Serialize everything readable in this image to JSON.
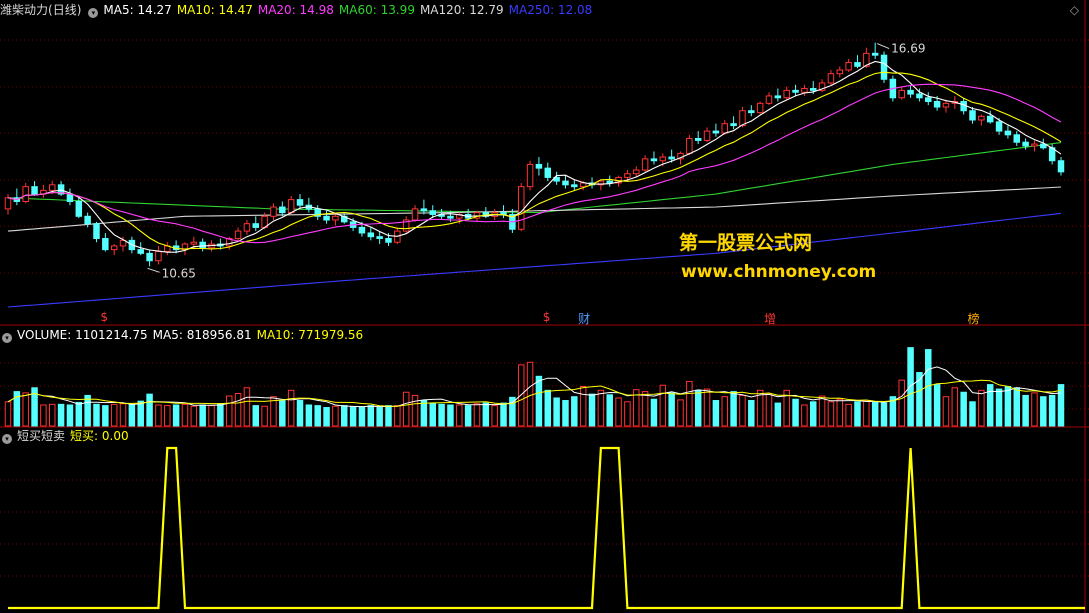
{
  "main_panel": {
    "stock_name": "潍柴动力",
    "period": "(日线)",
    "ma_labels": [
      {
        "text": "MA5: 14.27",
        "color": "#ffffff"
      },
      {
        "text": "MA10: 14.47",
        "color": "#ffff00"
      },
      {
        "text": "MA20: 14.98",
        "color": "#ff3cff"
      },
      {
        "text": "MA60: 13.99",
        "color": "#2fd32f"
      },
      {
        "text": "MA120: 12.79",
        "color": "#d8d8d8"
      },
      {
        "text": "MA250: 12.08",
        "color": "#3a3aff"
      }
    ],
    "high_label": "16.69",
    "low_label": "10.65",
    "close_glyph": "◇",
    "events": [
      {
        "text": "$",
        "color": "#ff3333"
      },
      {
        "text": "$",
        "color": "#ff3333"
      },
      {
        "text": "财",
        "color": "#5599ff"
      },
      {
        "text": "增",
        "color": "#ff3333"
      },
      {
        "text": "榜",
        "color": "#ffaa00"
      }
    ]
  },
  "watermark": {
    "line1": "第一股票公式网",
    "line2": "www.chnmoney.com"
  },
  "volume_panel": {
    "labels": [
      {
        "text": "VOLUME: 1101214.75",
        "color": "#ffffff"
      },
      {
        "text": "MA5: 818956.81",
        "color": "#ffffff"
      },
      {
        "text": "MA10: 771979.56",
        "color": "#ffff00"
      }
    ]
  },
  "indicator_panel": {
    "name": "短买短卖",
    "labels": [
      {
        "text": "短买: 0.00",
        "color": "#ffff00"
      }
    ]
  },
  "colors": {
    "up": "#ff3333",
    "down": "#55ffff",
    "grid": "#7a0000",
    "separator": "#a00000",
    "signal": "#ffff00"
  },
  "chart_data": [
    {
      "type": "candlestick",
      "title": "潍柴动力 (日线)",
      "x_count": 120,
      "price_range": [
        9.2,
        17.3
      ],
      "ohlc": [
        [
          12.2,
          12.6,
          12.05,
          12.5
        ],
        [
          12.5,
          12.75,
          12.3,
          12.4
        ],
        [
          12.4,
          12.9,
          12.35,
          12.8
        ],
        [
          12.8,
          12.95,
          12.55,
          12.6
        ],
        [
          12.6,
          12.85,
          12.5,
          12.7
        ],
        [
          12.7,
          12.95,
          12.6,
          12.85
        ],
        [
          12.85,
          12.95,
          12.55,
          12.6
        ],
        [
          12.6,
          12.75,
          12.3,
          12.4
        ],
        [
          12.4,
          12.5,
          11.95,
          12.0
        ],
        [
          12.0,
          12.1,
          11.7,
          11.8
        ],
        [
          11.8,
          11.85,
          11.3,
          11.4
        ],
        [
          11.4,
          11.55,
          11.05,
          11.1
        ],
        [
          11.1,
          11.25,
          10.95,
          11.2
        ],
        [
          11.2,
          11.45,
          11.05,
          11.35
        ],
        [
          11.35,
          11.45,
          11.0,
          11.1
        ],
        [
          11.1,
          11.3,
          10.95,
          11.0
        ],
        [
          11.0,
          11.1,
          10.65,
          10.8
        ],
        [
          10.8,
          11.2,
          10.7,
          11.05
        ],
        [
          11.05,
          11.3,
          10.95,
          11.2
        ],
        [
          11.2,
          11.35,
          11.0,
          11.1
        ],
        [
          11.1,
          11.3,
          10.95,
          11.25
        ],
        [
          11.25,
          11.45,
          11.1,
          11.3
        ],
        [
          11.3,
          11.4,
          11.05,
          11.15
        ],
        [
          11.15,
          11.35,
          11.05,
          11.25
        ],
        [
          11.25,
          11.4,
          11.1,
          11.2
        ],
        [
          11.2,
          11.45,
          11.1,
          11.4
        ],
        [
          11.4,
          11.7,
          11.3,
          11.6
        ],
        [
          11.6,
          11.9,
          11.5,
          11.8
        ],
        [
          11.8,
          12.0,
          11.6,
          11.7
        ],
        [
          11.7,
          12.1,
          11.65,
          12.0
        ],
        [
          12.0,
          12.35,
          11.9,
          12.25
        ],
        [
          12.25,
          12.4,
          12.0,
          12.1
        ],
        [
          12.1,
          12.55,
          12.05,
          12.45
        ],
        [
          12.45,
          12.6,
          12.2,
          12.3
        ],
        [
          12.3,
          12.5,
          12.1,
          12.2
        ],
        [
          12.2,
          12.3,
          11.9,
          12.0
        ],
        [
          12.0,
          12.15,
          11.8,
          11.9
        ],
        [
          11.9,
          12.05,
          11.75,
          12.0
        ],
        [
          12.0,
          12.1,
          11.8,
          11.85
        ],
        [
          11.85,
          11.95,
          11.6,
          11.7
        ],
        [
          11.7,
          11.85,
          11.45,
          11.55
        ],
        [
          11.55,
          11.7,
          11.35,
          11.45
        ],
        [
          11.45,
          11.6,
          11.25,
          11.4
        ],
        [
          11.4,
          11.55,
          11.2,
          11.3
        ],
        [
          11.3,
          11.7,
          11.25,
          11.6
        ],
        [
          11.6,
          12.0,
          11.55,
          11.9
        ],
        [
          11.9,
          12.3,
          11.85,
          12.2
        ],
        [
          12.2,
          12.45,
          12.05,
          12.15
        ],
        [
          12.15,
          12.3,
          11.95,
          12.05
        ],
        [
          12.05,
          12.2,
          11.9,
          12.0
        ],
        [
          12.0,
          12.15,
          11.85,
          11.95
        ],
        [
          11.95,
          12.1,
          11.8,
          12.05
        ],
        [
          12.05,
          12.2,
          11.9,
          11.95
        ],
        [
          11.95,
          12.15,
          11.85,
          12.1
        ],
        [
          12.1,
          12.25,
          11.95,
          12.0
        ],
        [
          12.0,
          12.2,
          11.9,
          12.1
        ],
        [
          12.1,
          12.3,
          11.95,
          12.05
        ],
        [
          12.05,
          12.2,
          11.55,
          11.65
        ],
        [
          11.65,
          12.9,
          11.6,
          12.8
        ],
        [
          12.8,
          13.5,
          12.7,
          13.4
        ],
        [
          13.4,
          13.6,
          13.1,
          13.3
        ],
        [
          13.3,
          13.45,
          12.95,
          13.05
        ],
        [
          13.05,
          13.2,
          12.85,
          12.95
        ],
        [
          12.95,
          13.1,
          12.75,
          12.85
        ],
        [
          12.85,
          13.0,
          12.7,
          12.8
        ],
        [
          12.8,
          12.95,
          12.7,
          12.9
        ],
        [
          12.9,
          13.05,
          12.75,
          12.85
        ],
        [
          12.85,
          13.0,
          12.7,
          12.95
        ],
        [
          12.95,
          13.1,
          12.8,
          12.9
        ],
        [
          12.9,
          13.1,
          12.8,
          13.05
        ],
        [
          13.05,
          13.25,
          12.95,
          13.15
        ],
        [
          13.15,
          13.35,
          13.05,
          13.25
        ],
        [
          13.25,
          13.65,
          13.2,
          13.55
        ],
        [
          13.55,
          13.75,
          13.4,
          13.5
        ],
        [
          13.5,
          13.7,
          13.35,
          13.6
        ],
        [
          13.6,
          13.8,
          13.45,
          13.55
        ],
        [
          13.55,
          13.75,
          13.4,
          13.7
        ],
        [
          13.7,
          14.2,
          13.65,
          14.1
        ],
        [
          14.1,
          14.3,
          13.95,
          14.05
        ],
        [
          14.05,
          14.4,
          14.0,
          14.3
        ],
        [
          14.3,
          14.5,
          14.15,
          14.25
        ],
        [
          14.25,
          14.6,
          14.2,
          14.5
        ],
        [
          14.5,
          14.7,
          14.35,
          14.45
        ],
        [
          14.45,
          14.95,
          14.4,
          14.85
        ],
        [
          14.85,
          15.0,
          14.7,
          14.8
        ],
        [
          14.8,
          15.1,
          14.75,
          15.05
        ],
        [
          15.05,
          15.35,
          15.0,
          15.25
        ],
        [
          15.25,
          15.45,
          15.1,
          15.2
        ],
        [
          15.2,
          15.5,
          15.15,
          15.4
        ],
        [
          15.4,
          15.55,
          15.25,
          15.35
        ],
        [
          15.35,
          15.55,
          15.25,
          15.45
        ],
        [
          15.45,
          15.65,
          15.3,
          15.4
        ],
        [
          15.4,
          15.7,
          15.35,
          15.6
        ],
        [
          15.6,
          15.95,
          15.55,
          15.85
        ],
        [
          15.85,
          16.05,
          15.75,
          15.95
        ],
        [
          15.95,
          16.25,
          15.9,
          16.15
        ],
        [
          16.15,
          16.35,
          16.0,
          16.05
        ],
        [
          16.05,
          16.55,
          16.0,
          16.4
        ],
        [
          16.4,
          16.69,
          16.25,
          16.35
        ],
        [
          16.35,
          16.45,
          15.6,
          15.7
        ],
        [
          15.7,
          15.8,
          15.1,
          15.2
        ],
        [
          15.2,
          15.5,
          15.15,
          15.4
        ],
        [
          15.4,
          15.55,
          15.2,
          15.3
        ],
        [
          15.3,
          15.45,
          15.1,
          15.2
        ],
        [
          15.2,
          15.35,
          15.0,
          15.1
        ],
        [
          15.1,
          15.25,
          14.85,
          14.95
        ],
        [
          14.95,
          15.15,
          14.8,
          15.05
        ],
        [
          15.05,
          15.25,
          14.9,
          15.1
        ],
        [
          15.1,
          15.2,
          14.75,
          14.85
        ],
        [
          14.85,
          14.95,
          14.5,
          14.6
        ],
        [
          14.6,
          14.75,
          14.45,
          14.7
        ],
        [
          14.7,
          14.85,
          14.5,
          14.55
        ],
        [
          14.55,
          14.65,
          14.2,
          14.3
        ],
        [
          14.3,
          14.45,
          14.1,
          14.2
        ],
        [
          14.2,
          14.3,
          13.9,
          14.0
        ],
        [
          14.0,
          14.1,
          13.8,
          13.9
        ],
        [
          13.9,
          14.05,
          13.75,
          13.95
        ],
        [
          13.95,
          14.1,
          13.8,
          13.85
        ],
        [
          13.85,
          13.95,
          13.4,
          13.5
        ],
        [
          13.5,
          13.6,
          13.1,
          13.2
        ]
      ],
      "ma_series": [
        {
          "name": "MA5",
          "color": "#ffffff"
        },
        {
          "name": "MA10",
          "color": "#ffff00"
        },
        {
          "name": "MA20",
          "color": "#ff3cff"
        },
        {
          "name": "MA60",
          "color": "#2fd32f",
          "anchors": [
            [
              0,
              12.5
            ],
            [
              30,
              12.2
            ],
            [
              60,
              12.1
            ],
            [
              80,
              12.6
            ],
            [
              100,
              13.4
            ],
            [
              119,
              13.99
            ]
          ]
        },
        {
          "name": "MA120",
          "color": "#d8d8d8",
          "anchors": [
            [
              0,
              11.6
            ],
            [
              20,
              12.0
            ],
            [
              50,
              12.1
            ],
            [
              80,
              12.25
            ],
            [
              100,
              12.55
            ],
            [
              119,
              12.79
            ]
          ]
        },
        {
          "name": "MA250",
          "color": "#3a3aff",
          "anchors": [
            [
              0,
              9.55
            ],
            [
              40,
              10.3
            ],
            [
              80,
              11.0
            ],
            [
              100,
              11.55
            ],
            [
              119,
              12.08
            ]
          ]
        }
      ]
    },
    {
      "type": "bar",
      "title": "VOLUME",
      "volume_max": 1350000,
      "volumes": [
        380000,
        540000,
        520000,
        600000,
        330000,
        340000,
        340000,
        330000,
        370000,
        480000,
        340000,
        320000,
        340000,
        350000,
        340000,
        390000,
        500000,
        330000,
        320000,
        330000,
        340000,
        310000,
        330000,
        320000,
        350000,
        470000,
        510000,
        600000,
        320000,
        310000,
        460000,
        400000,
        560000,
        400000,
        330000,
        320000,
        290000,
        310000,
        320000,
        300000,
        300000,
        320000,
        290000,
        320000,
        320000,
        530000,
        480000,
        400000,
        360000,
        340000,
        330000,
        330000,
        320000,
        350000,
        360000,
        320000,
        360000,
        450000,
        960000,
        1000000,
        780000,
        560000,
        440000,
        400000,
        460000,
        620000,
        500000,
        560000,
        490000,
        440000,
        380000,
        570000,
        540000,
        420000,
        640000,
        520000,
        410000,
        700000,
        560000,
        580000,
        400000,
        460000,
        540000,
        480000,
        400000,
        560000,
        500000,
        360000,
        560000,
        420000,
        330000,
        380000,
        470000,
        380000,
        420000,
        340000,
        380000,
        400000,
        380000,
        360000,
        460000,
        720000,
        1230000,
        840000,
        1200000,
        650000,
        460000,
        600000,
        530000,
        380000,
        560000,
        650000,
        580000,
        620000,
        600000,
        480000,
        520000,
        460000,
        480000,
        650000
      ],
      "volume_ma5": 818956.81,
      "volume_ma10": 771979.56
    },
    {
      "type": "line",
      "title": "短买短卖",
      "series": [
        {
          "name": "短买",
          "value": 0.0
        }
      ],
      "ylim": [
        0,
        1
      ],
      "pulses": [
        [
          18,
          19
        ],
        [
          67,
          69
        ],
        [
          102,
          102
        ]
      ]
    }
  ]
}
